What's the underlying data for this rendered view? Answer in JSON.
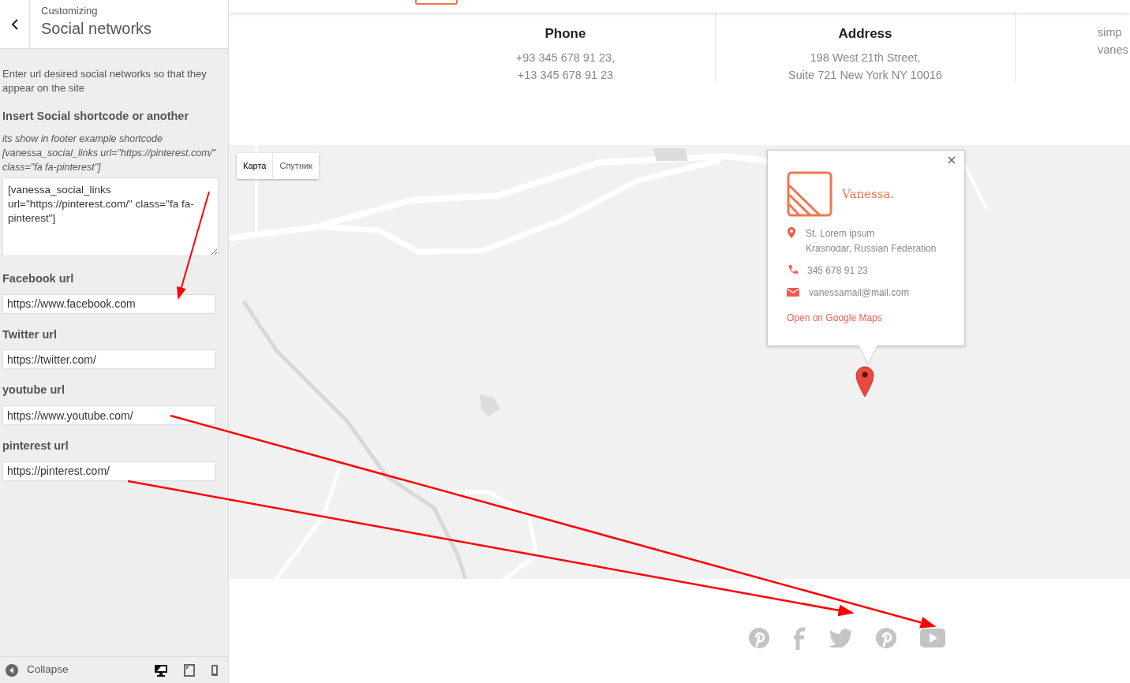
{
  "sidebar": {
    "subtitle": "Customizing",
    "title": "Social networks",
    "description": "Enter url desired social networks so that they appear on the site",
    "shortcode": {
      "label": "Insert Social shortcode or another",
      "help": "its show in footer example shortcode [vanessa_social_links url=\"https://pinterest.com/\" class=\"fa fa-pinterest\"]",
      "value": "[vanessa_social_links url=\"https://pinterest.com/\" class=\"fa fa-pinterest\"]"
    },
    "url_fields": [
      {
        "label": "Facebook url",
        "value": "https://www.facebook.com"
      },
      {
        "label": "Twitter url",
        "value": "https://twitter.com/"
      },
      {
        "label": "youtube url",
        "value": "https://www.youtube.com/"
      },
      {
        "label": "pinterest url",
        "value": "https://pinterest.com/"
      }
    ],
    "footer": {
      "collapse_label": "Collapse",
      "devices": [
        {
          "kind": "desktop",
          "selected": true
        },
        {
          "kind": "tablet",
          "selected": false
        },
        {
          "kind": "mobile",
          "selected": false
        }
      ]
    }
  },
  "preview": {
    "contact_columns": [
      {
        "heading": "Phone",
        "lines": [
          "+93 345 678 91 23,",
          "+13 345 678 91 23"
        ]
      },
      {
        "heading": "Address",
        "lines": [
          "198 West 21th Street,",
          "Suite 721 New York NY 10016"
        ]
      },
      {
        "lines": [
          "simp",
          "vanes"
        ]
      }
    ],
    "map": {
      "type_buttons": [
        {
          "label": "Карта",
          "selected": true
        },
        {
          "label": "Спутник",
          "selected": false
        }
      ],
      "popup": {
        "brand": "Vanessa.",
        "address_lines": [
          "St. Lorem ipsum",
          "Krasnodar, Russian Federation"
        ],
        "phone": "345 678 91 23",
        "email": "vanessamail@mail.com",
        "link": "Open on Google Maps"
      }
    },
    "social_icons": [
      {
        "kind": "pinterest"
      },
      {
        "kind": "facebook"
      },
      {
        "kind": "twitter"
      },
      {
        "kind": "pinterest"
      },
      {
        "kind": "youtube"
      }
    ]
  }
}
